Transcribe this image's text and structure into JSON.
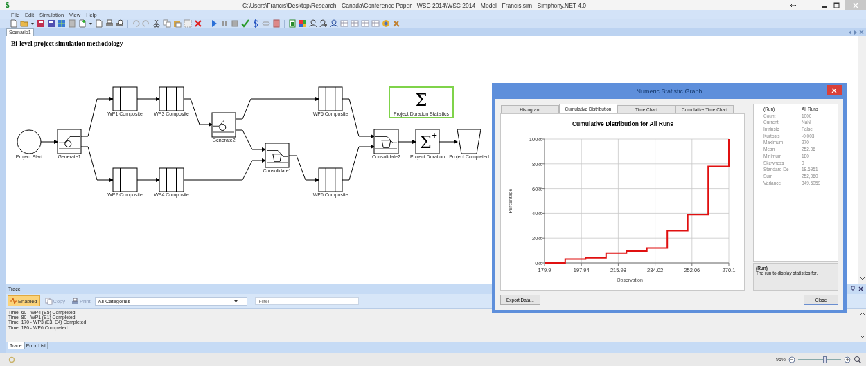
{
  "window": {
    "app_icon": "$",
    "title": "C:\\Users\\Francis\\Desktop\\Research - Canada\\Conference Paper - WSC 2014\\WSC 2014 - Model - Francis.sim - Simphony.NET 4.0"
  },
  "menu": [
    "File",
    "Edit",
    "Simulation",
    "View",
    "Help"
  ],
  "document_tabs": [
    {
      "label": "Scenario1",
      "selected": true
    }
  ],
  "canvas": {
    "title": "Bi-level project simulation methodology",
    "nodes": [
      {
        "kind": "start",
        "label": "Project Start",
        "selected": false
      },
      {
        "kind": "generate",
        "label": "Generate1",
        "selected": false
      },
      {
        "kind": "composite",
        "label": "WP1 Composite",
        "selected": false
      },
      {
        "kind": "composite",
        "label": "WP3 Composite",
        "selected": false
      },
      {
        "kind": "composite",
        "label": "WP2 Composite",
        "selected": false
      },
      {
        "kind": "composite",
        "label": "WP4 Composite",
        "selected": false
      },
      {
        "kind": "generate",
        "label": "Generate2",
        "selected": false
      },
      {
        "kind": "consolidate",
        "label": "Consolidate1",
        "selected": false
      },
      {
        "kind": "composite",
        "label": "WP5 Composite",
        "selected": false
      },
      {
        "kind": "composite",
        "label": "WP6 Composite",
        "selected": false
      },
      {
        "kind": "statistics",
        "label": "Project Duration Statistics",
        "symbol": "Σ",
        "selected": true
      },
      {
        "kind": "consolidate",
        "label": "Consolidate2",
        "selected": false
      },
      {
        "kind": "duration",
        "label": "Project Duration",
        "symbol": "Σ",
        "symbol_sup": "+",
        "selected": false
      },
      {
        "kind": "sink",
        "label": "Project Completed",
        "selected": false
      }
    ]
  },
  "dialog": {
    "title": "Numeric Statistic Graph",
    "tabs": [
      {
        "label": "Histogram",
        "selected": false
      },
      {
        "label": "Cumulative Distribution",
        "selected": true
      },
      {
        "label": "Time Chart",
        "selected": false
      },
      {
        "label": "Cumulative Time Chart",
        "selected": false
      }
    ],
    "chart_data": {
      "type": "line",
      "title": "Cumulative Distribution for All Runs",
      "xlabel": "Observation",
      "ylabel": "Percentage",
      "x": [
        179.9,
        190,
        190,
        200,
        200,
        210,
        210,
        220,
        220,
        230,
        230,
        240,
        240,
        250,
        250,
        260,
        260,
        270.1,
        270.1
      ],
      "grid": true,
      "series": [
        {
          "color": "#e01010",
          "values": [
            0,
            0,
            3,
            3,
            4,
            4,
            8,
            8,
            9.5,
            9.5,
            12,
            12,
            26,
            26,
            39,
            39,
            78,
            78,
            100
          ]
        }
      ],
      "xlim": [
        179.9,
        270.1
      ],
      "ylim": [
        0,
        100
      ],
      "xticks": [
        179.9,
        197.94,
        215.98,
        234.02,
        252.06,
        270.1
      ],
      "yticks": [
        {
          "value": 0,
          "label": "0%"
        },
        {
          "value": 20,
          "label": "20%"
        },
        {
          "value": 40,
          "label": "40%"
        },
        {
          "value": 60,
          "label": "60%"
        },
        {
          "value": 80,
          "label": "80%"
        },
        {
          "value": 100,
          "label": "100%"
        }
      ]
    },
    "properties": [
      {
        "name": "(Run)",
        "value": "All Runs",
        "disabled": false
      },
      {
        "name": "Count",
        "value": "1000",
        "disabled": true
      },
      {
        "name": "Current",
        "value": "NaN",
        "disabled": true
      },
      {
        "name": "Intrinsic",
        "value": "False",
        "disabled": true
      },
      {
        "name": "Kurtosis",
        "value": "-0.003",
        "disabled": true
      },
      {
        "name": "Maximum",
        "value": "270",
        "disabled": true
      },
      {
        "name": "Mean",
        "value": "252.06",
        "disabled": true
      },
      {
        "name": "Minimum",
        "value": "180",
        "disabled": true
      },
      {
        "name": "Skewness",
        "value": "0",
        "disabled": true
      },
      {
        "name": "Standard De",
        "value": "18.6951",
        "disabled": true
      },
      {
        "name": "Sum",
        "value": "252,060",
        "disabled": true
      },
      {
        "name": "Variance",
        "value": "349.5059",
        "disabled": true
      }
    ],
    "description": {
      "title": "(Run)",
      "text": "The run to display statistics for."
    },
    "buttons": [
      "Export Data...",
      "Close"
    ]
  },
  "trace": {
    "title": "Trace",
    "enabled": {
      "label": "Enabled",
      "on": true
    },
    "copy": "Copy",
    "print": "Print",
    "category": "All Categories",
    "filter": {
      "placeholder": "Filter"
    },
    "lines": [
      "Time: 60 - WP4 (E5) Completed",
      "Time: 80 - WP1 (E1) Completed",
      "Time: 170 - WP3 (E3, E4) Completed",
      "Time: 180 - WP6 Completed"
    ]
  },
  "bottom_tabs": [
    {
      "label": "Trace",
      "selected": true
    },
    {
      "label": "Error List",
      "selected": false
    }
  ],
  "status_bar": {
    "zoom": "95%",
    "zoom_slider": {
      "level": 0.62
    }
  }
}
